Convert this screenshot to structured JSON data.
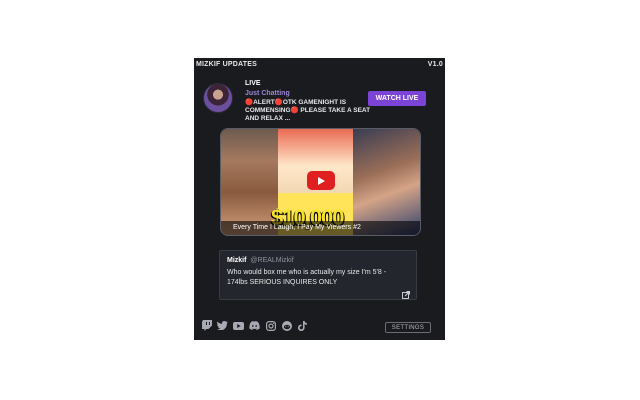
{
  "header": {
    "app_title": "MIZKIF UPDATES",
    "version": "V1.0"
  },
  "live": {
    "status_label": "LIVE",
    "category": "Just Chatting",
    "stream_title": "🔴ALERT🔴OTK GAMENIGHT IS COMMENSING🔴 PLEASE TAKE A SEAT AND RELAX ...",
    "watch_button": "WATCH LIVE"
  },
  "video": {
    "title": "Every Time I Laugh, I Pay My Viewers #2",
    "thumbnail_text": "$10,000"
  },
  "tweet": {
    "author_name": "Mizkif",
    "author_handle": "@REALMizkif",
    "text": "Who would box me who is actually my size I'm 5'8 - 174lbs SERIOUS INQUIRES ONLY"
  },
  "socials": [
    {
      "icon": "twitch-icon"
    },
    {
      "icon": "twitter-icon"
    },
    {
      "icon": "youtube-icon"
    },
    {
      "icon": "discord-icon"
    },
    {
      "icon": "instagram-icon"
    },
    {
      "icon": "reddit-icon"
    },
    {
      "icon": "tiktok-icon"
    }
  ],
  "footer": {
    "settings_label": "SETTINGS"
  },
  "colors": {
    "panel_bg": "#1a1b1f",
    "accent": "#7b44d6",
    "category": "#9c85d6",
    "play": "#e02020"
  }
}
